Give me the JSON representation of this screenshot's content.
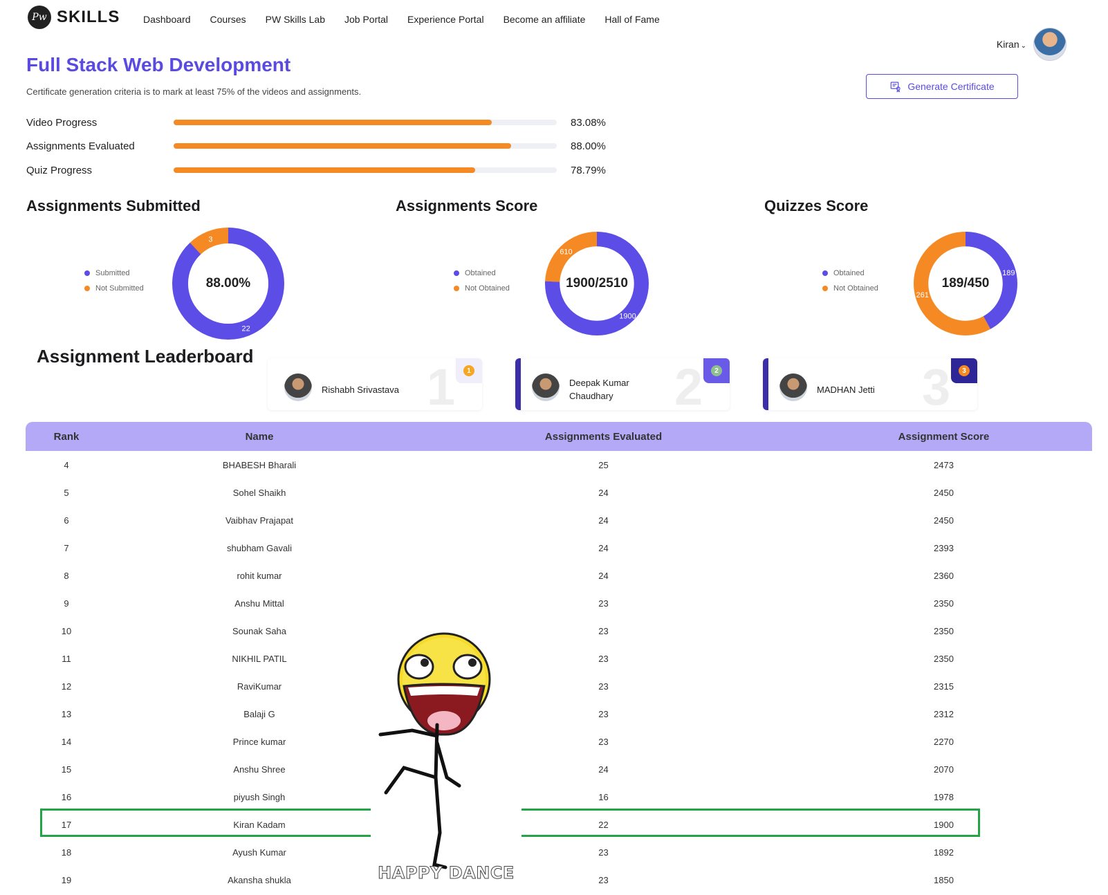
{
  "brand": {
    "badge": "Pw",
    "name": "SKILLS"
  },
  "nav": [
    "Dashboard",
    "Courses",
    "PW Skills Lab",
    "Job Portal",
    "Experience Portal",
    "Become an affiliate",
    "Hall of Fame"
  ],
  "user": {
    "name": "Kiran"
  },
  "course": {
    "title": "Full Stack Web Development",
    "criteria": "Certificate generation criteria is to mark at least 75% of the videos and assignments.",
    "certificate_button": "Generate Certificate"
  },
  "progress": [
    {
      "label": "Video Progress",
      "value": "83.08%",
      "fraction": 0.8308
    },
    {
      "label": "Assignments Evaluated",
      "value": "88.00%",
      "fraction": 0.88
    },
    {
      "label": "Quiz Progress",
      "value": "78.79%",
      "fraction": 0.7879
    }
  ],
  "colors": {
    "primary": "#5a4be0",
    "orange": "#f58a24",
    "donut_blue": "#5b4de6",
    "table_header": "#b4a9f7",
    "highlight": "#22a447"
  },
  "stats": [
    {
      "title": "Assignments Submitted",
      "center": "88.00%",
      "legend": [
        "Submitted",
        "Not Submitted"
      ],
      "segments": [
        {
          "label": "22",
          "value": 22,
          "color": "#5b4de6"
        },
        {
          "label": "3",
          "value": 3,
          "color": "#f58a24"
        }
      ]
    },
    {
      "title": "Assignments Score",
      "center": "1900/2510",
      "legend": [
        "Obtained",
        "Not Obtained"
      ],
      "segments": [
        {
          "label": "1900",
          "value": 1900,
          "color": "#5b4de6"
        },
        {
          "label": "610",
          "value": 610,
          "color": "#f58a24"
        }
      ]
    },
    {
      "title": "Quizzes Score",
      "center": "189/450",
      "legend": [
        "Obtained",
        "Not Obtained"
      ],
      "segments": [
        {
          "label": "189",
          "value": 189,
          "color": "#5b4de6"
        },
        {
          "label": "261",
          "value": 261,
          "color": "#f58a24"
        }
      ]
    }
  ],
  "leaderboard": {
    "title": "Assignment Leaderboard",
    "top": [
      {
        "rank": "1",
        "name": "Rishabh Srivastava",
        "medal": "1",
        "badge_bg": "#f1eefc",
        "medal_color": "#f5a623"
      },
      {
        "rank": "2",
        "name": "Deepak Kumar Chaudhary",
        "medal": "2",
        "badge_bg": "#6a5ae8",
        "medal_color": "#8fbf8f"
      },
      {
        "rank": "3",
        "name": "MADHAN Jetti",
        "medal": "3",
        "badge_bg": "#2e2596",
        "medal_color": "#f58a24"
      }
    ],
    "columns": [
      "Rank",
      "Name",
      "Assignments Evaluated",
      "Assignment Score"
    ],
    "rows": [
      [
        "4",
        "BHABESH Bharali",
        "25",
        "2473"
      ],
      [
        "5",
        "Sohel Shaikh",
        "24",
        "2450"
      ],
      [
        "6",
        "Vaibhav Prajapat",
        "24",
        "2450"
      ],
      [
        "7",
        "shubham Gavali",
        "24",
        "2393"
      ],
      [
        "8",
        "rohit kumar",
        "24",
        "2360"
      ],
      [
        "9",
        "Anshu Mittal",
        "23",
        "2350"
      ],
      [
        "10",
        "Sounak Saha",
        "23",
        "2350"
      ],
      [
        "11",
        "NIKHIL PATIL",
        "23",
        "2350"
      ],
      [
        "12",
        "RaviKumar",
        "23",
        "2315"
      ],
      [
        "13",
        "Balaji G",
        "23",
        "2312"
      ],
      [
        "14",
        "Prince kumar",
        "23",
        "2270"
      ],
      [
        "15",
        "Anshu Shree",
        "24",
        "2070"
      ],
      [
        "16",
        "piyush Singh",
        "16",
        "1978"
      ],
      [
        "17",
        "Kiran Kadam",
        "22",
        "1900"
      ],
      [
        "18",
        "Ayush Kumar",
        "23",
        "1892"
      ],
      [
        "19",
        "Akansha shukla",
        "23",
        "1850"
      ]
    ]
  },
  "meme": {
    "caption": "HAPPY DANCE"
  }
}
